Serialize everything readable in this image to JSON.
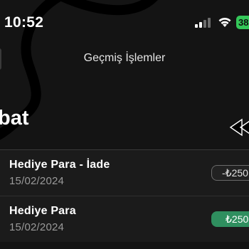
{
  "status_bar": {
    "time": "10:52",
    "battery": "38",
    "icons": [
      "signal-icon",
      "wifi-icon",
      "battery-icon"
    ]
  },
  "header": {
    "title": "Geçmiş İşlemler"
  },
  "section": {
    "title": "bat",
    "icon": "rewind-icon"
  },
  "transactions": [
    {
      "name": "Hediye Para - İade",
      "date": "15/02/2024",
      "amount": "-₺250",
      "type": "negative"
    },
    {
      "name": "Hediye Para",
      "date": "15/02/2024",
      "amount": "₺250",
      "type": "positive"
    }
  ],
  "colors": {
    "background": "#141414",
    "positive": "#2f8f5f",
    "battery": "#34c759"
  }
}
